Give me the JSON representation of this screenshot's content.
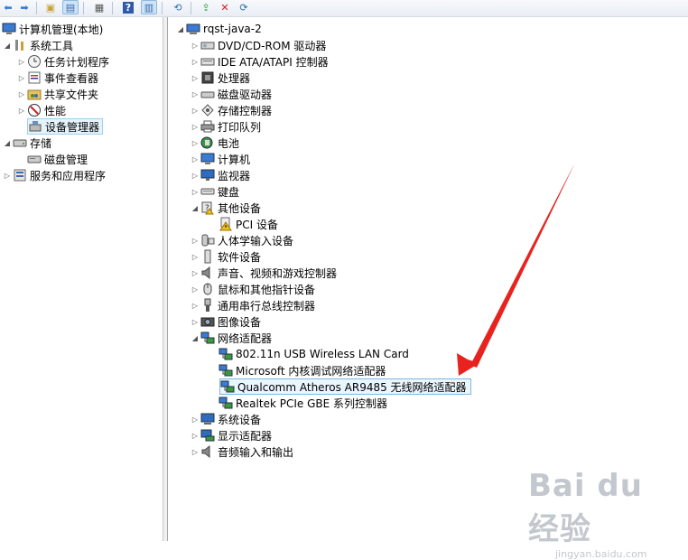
{
  "toolbar": {
    "buttons": [
      {
        "icon": "back-arrow-icon"
      },
      {
        "icon": "forward-arrow-icon"
      },
      {
        "icon": "up-folder-icon"
      },
      {
        "icon": "show-tree-icon"
      },
      {
        "icon": "export-list-icon"
      },
      {
        "icon": "help-icon"
      },
      {
        "icon": "action-pane-icon"
      },
      {
        "icon": "scan-hardware-icon"
      },
      {
        "icon": "update-driver-icon"
      },
      {
        "icon": "uninstall-icon"
      },
      {
        "icon": "enable-device-icon"
      }
    ]
  },
  "left_tree": {
    "root": "计算机管理(本地)",
    "system_tools": "系统工具",
    "task_scheduler": "任务计划程序",
    "event_viewer": "事件查看器",
    "shared_folders": "共享文件夹",
    "performance": "性能",
    "device_manager": "设备管理器",
    "storage": "存储",
    "disk_management": "磁盘管理",
    "services_apps": "服务和应用程序"
  },
  "device_tree": {
    "computer_name": "rqst-java-2",
    "categories": {
      "dvd": "DVD/CD-ROM 驱动器",
      "ide": "IDE ATA/ATAPI 控制器",
      "processor": "处理器",
      "disk": "磁盘驱动器",
      "storage_ctrl": "存储控制器",
      "print_queue": "打印队列",
      "battery": "电池",
      "computer": "计算机",
      "monitor": "监视器",
      "keyboard": "键盘",
      "other": "其他设备",
      "hid": "人体学输入设备",
      "software": "软件设备",
      "sound": "声音、视频和游戏控制器",
      "mouse": "鼠标和其他指针设备",
      "usb": "通用串行总线控制器",
      "imaging": "图像设备",
      "network": "网络适配器",
      "system": "系统设备",
      "display": "显示适配器",
      "audio_io": "音频输入和输出"
    },
    "other_children": {
      "pci": "PCI 设备"
    },
    "network_children": {
      "wifi_usb": "802.11n USB Wireless LAN Card",
      "ms_debug": "Microsoft 内核调试网络适配器",
      "qualcomm": "Qualcomm Atheros AR9485 无线网络适配器",
      "realtek": "Realtek PCIe GBE 系列控制器"
    }
  },
  "annotation": {
    "arrow_color": "#e8231f"
  },
  "watermark": {
    "brand": "Bai du 经验",
    "url": "jingyan.baidu.com"
  },
  "colors": {
    "selection": "#e5f3fb",
    "highlight_border": "#7fb6e0"
  }
}
